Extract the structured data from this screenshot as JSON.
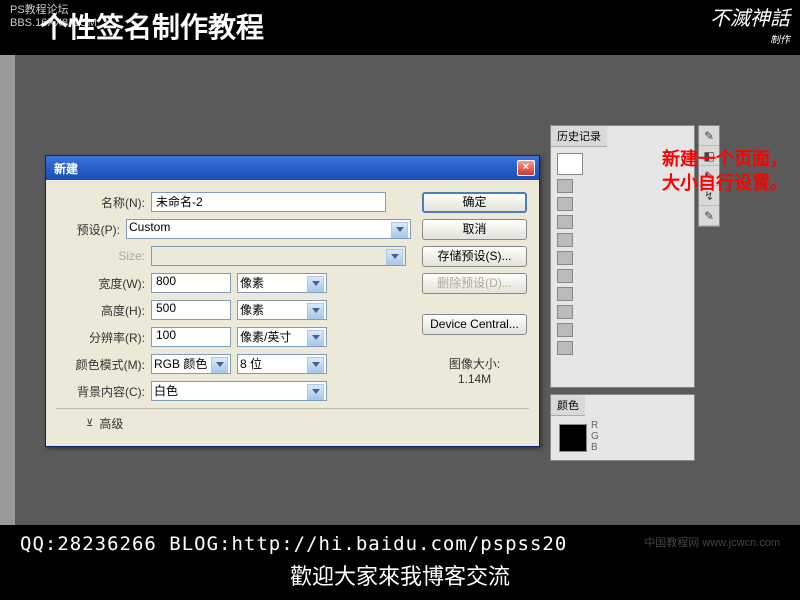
{
  "header": {
    "small_line1": "PS教程论坛",
    "small_line2": "BBS.16XX8.COM",
    "title": "个性签名制作教程",
    "logo_main": "不滅神話",
    "logo_sub": "制作"
  },
  "dialog": {
    "title": "新建",
    "labels": {
      "name": "名称(N):",
      "preset": "预设(P):",
      "size": "Size:",
      "width": "宽度(W):",
      "height": "高度(H):",
      "resolution": "分辨率(R):",
      "color_mode": "颜色模式(M):",
      "bg_content": "背景内容(C):",
      "advanced": "高级"
    },
    "values": {
      "name": "未命名-2",
      "preset": "Custom",
      "size": "",
      "width": "800",
      "width_unit": "像素",
      "height": "500",
      "height_unit": "像素",
      "resolution": "100",
      "resolution_unit": "像素/英寸",
      "color_mode": "RGB 颜色",
      "bit_depth": "8 位",
      "bg_content": "白色"
    },
    "buttons": {
      "ok": "确定",
      "cancel": "取消",
      "save_preset": "存储预设(S)...",
      "delete_preset": "删除预设(D)...",
      "device_central": "Device Central..."
    },
    "image_size_label": "图像大小:",
    "image_size_value": "1.14M"
  },
  "panels": {
    "history_tab": "历史记录",
    "color_tab": "颜色",
    "color_channels": {
      "r": "R",
      "g": "G",
      "b": "B"
    }
  },
  "annotation": "新建一个页面，大小自行设置。",
  "footer": {
    "line1": "QQ:28236266  BLOG:http://hi.baidu.com/pspss20",
    "line2": "歡迎大家來我博客交流",
    "watermark": "中国教程网 www.jcwcn.com"
  }
}
